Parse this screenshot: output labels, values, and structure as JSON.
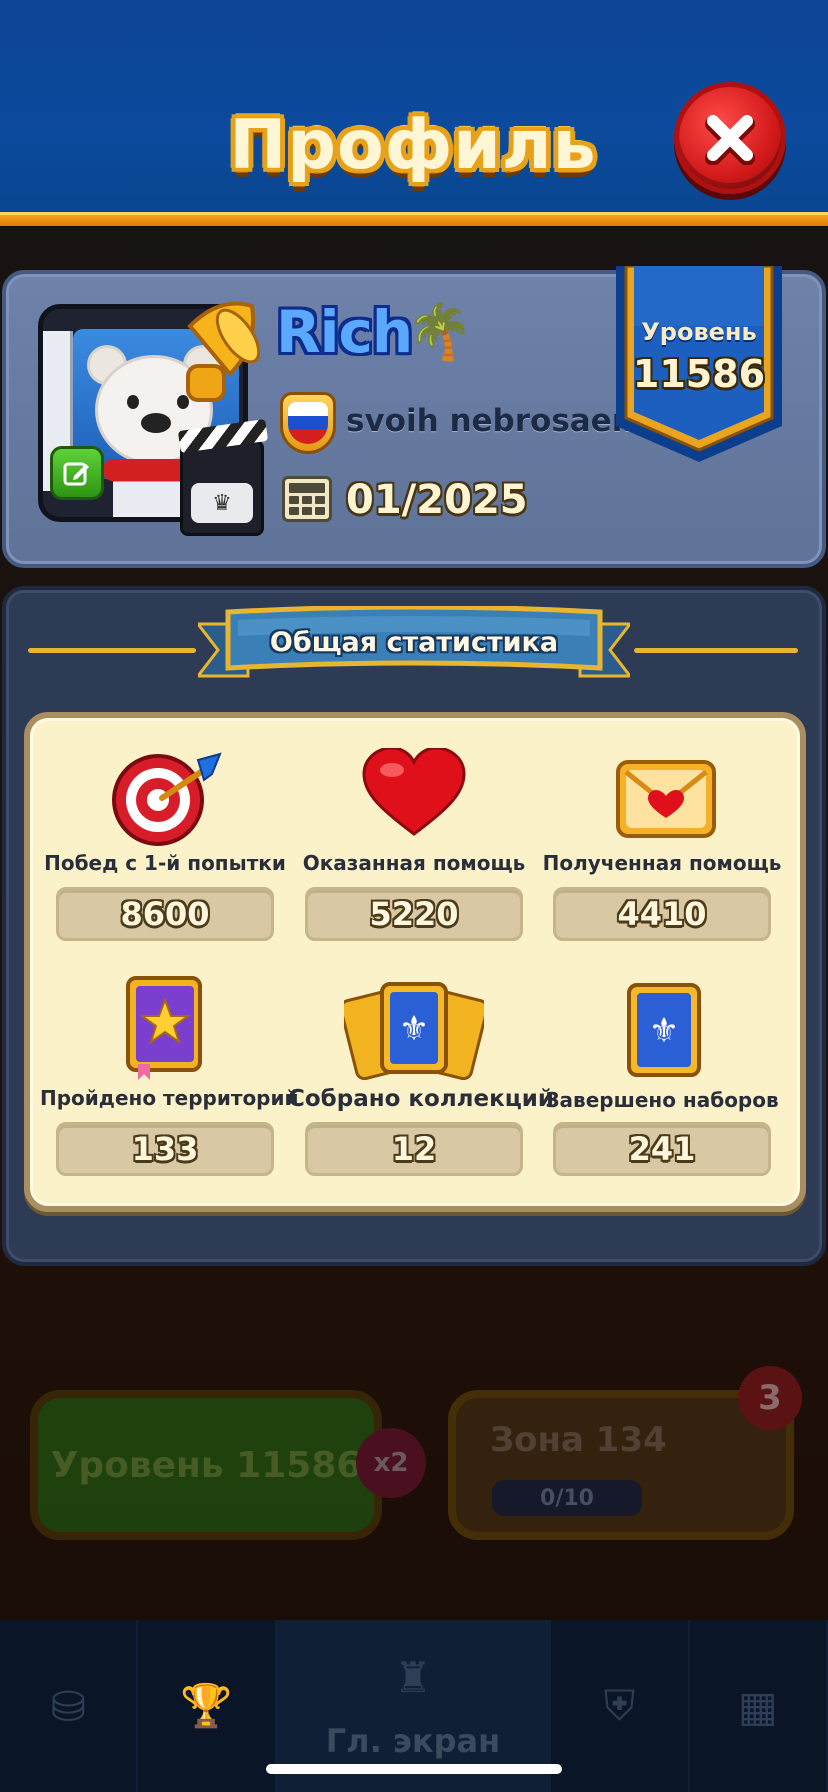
{
  "header": {
    "title": "Профиль",
    "close_icon": "close-icon"
  },
  "profile": {
    "name": "Rich",
    "name_suffix_icon": "palm-tree-icon",
    "team": {
      "flag": "russia-flag-icon",
      "name": "svoih nebrosaem"
    },
    "join_date": "01/2025",
    "level": {
      "label": "Уровень",
      "value": "11586"
    }
  },
  "stats": {
    "heading": "Общая статистика",
    "items": [
      {
        "icon": "target-icon",
        "label": "Побед с 1-й попытки",
        "value": "8600"
      },
      {
        "icon": "heart-icon",
        "label": "Оказанная помощь",
        "value": "5220"
      },
      {
        "icon": "envelope-heart-icon",
        "label": "Полученная помощь",
        "value": "4410"
      },
      {
        "icon": "album-star-icon",
        "label": "Пройдено территорий",
        "value": "133"
      },
      {
        "icon": "card-collection-icon",
        "label": "Собрано коллекций",
        "value": "12"
      },
      {
        "icon": "card-set-icon",
        "label": "Завершено наборов",
        "value": "241"
      }
    ]
  },
  "background": {
    "level_button": "Уровень 11586",
    "multiplier": "x2",
    "zone_title": "Зона 134",
    "zone_progress": "0/10",
    "zone_badge": "3",
    "nav_home_label": "Гл. экран"
  },
  "colors": {
    "header_bg": "#0b4a9d",
    "accent_orange": "#f7a51a",
    "close_red": "#d21a1a",
    "card_cream": "#fcf2c9"
  }
}
